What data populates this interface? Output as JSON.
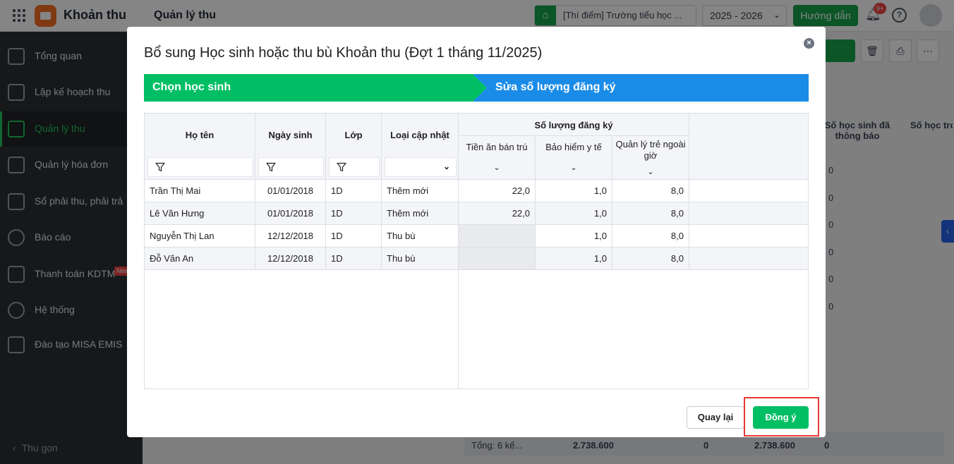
{
  "topbar": {
    "app_name": "Khoản thu",
    "page_title": "Quản lý thu",
    "school": "[Thí điểm] Trường tiểu học ...",
    "school_year": "2025 - 2026",
    "guide_label": "Hướng dẫn",
    "notification_badge": "9+"
  },
  "sidebar": {
    "items": [
      {
        "label": "Tổng quan"
      },
      {
        "label": "Lập kế hoạch thu"
      },
      {
        "label": "Quản lý thu"
      },
      {
        "label": "Quản lý hóa đơn"
      },
      {
        "label": "Sổ phải thu, phải trả"
      },
      {
        "label": "Báo cáo"
      },
      {
        "label": "Thanh toán KDTM"
      },
      {
        "label": "Hệ thống"
      },
      {
        "label": "Đào tạo MISA EMIS"
      }
    ],
    "new_badge": "New",
    "collapse_label": "Thu gọn"
  },
  "background": {
    "col_head_1": "Số học sinh đã thông báo",
    "col_head_2": "Số học trong",
    "cells": [
      "0",
      "0",
      "0",
      "0",
      "0",
      "0"
    ],
    "footer_total": "Tổng: 6 kế...",
    "footer_amount_1": "2.738.600",
    "footer_zero_1": "0",
    "footer_amount_2": "2.738.600",
    "footer_zero_2": "0"
  },
  "modal": {
    "title": "Bổ sung Học sinh hoặc thu bù Khoản thu (Đợt 1 tháng 11/2025)",
    "steps": [
      "Chọn học sinh",
      "Sửa số lượng đăng ký"
    ],
    "columns": {
      "name": "Họ tên",
      "dob": "Ngày sinh",
      "class": "Lớp",
      "update_type": "Loại cập nhật",
      "group": "Số lượng đăng ký",
      "meal": "Tiền ăn bán trú",
      "insurance": "Bảo hiểm y tế",
      "afterschool": "Quản lý trẻ ngoài giờ"
    },
    "rows": [
      {
        "name": "Trần Thị Mai",
        "dob": "01/01/2018",
        "class": "1D",
        "update_type": "Thêm mới",
        "meal": "22,0",
        "insurance": "1,0",
        "afterschool": "8,0"
      },
      {
        "name": "Lê Văn Hưng",
        "dob": "01/01/2018",
        "class": "1D",
        "update_type": "Thêm mới",
        "meal": "22,0",
        "insurance": "1,0",
        "afterschool": "8,0"
      },
      {
        "name": "Nguyễn Thị Lan",
        "dob": "12/12/2018",
        "class": "1D",
        "update_type": "Thu bù",
        "meal": "",
        "insurance": "1,0",
        "afterschool": "8,0"
      },
      {
        "name": "Đỗ Văn An",
        "dob": "12/12/2018",
        "class": "1D",
        "update_type": "Thu bù",
        "meal": "",
        "insurance": "1,0",
        "afterschool": "8,0"
      }
    ],
    "back_label": "Quay lại",
    "ok_label": "Đồng ý"
  },
  "colors": {
    "step_active": "#00be64",
    "step_next": "#1a8ce8",
    "primary_green": "#00be64",
    "highlight": "#e53935"
  }
}
